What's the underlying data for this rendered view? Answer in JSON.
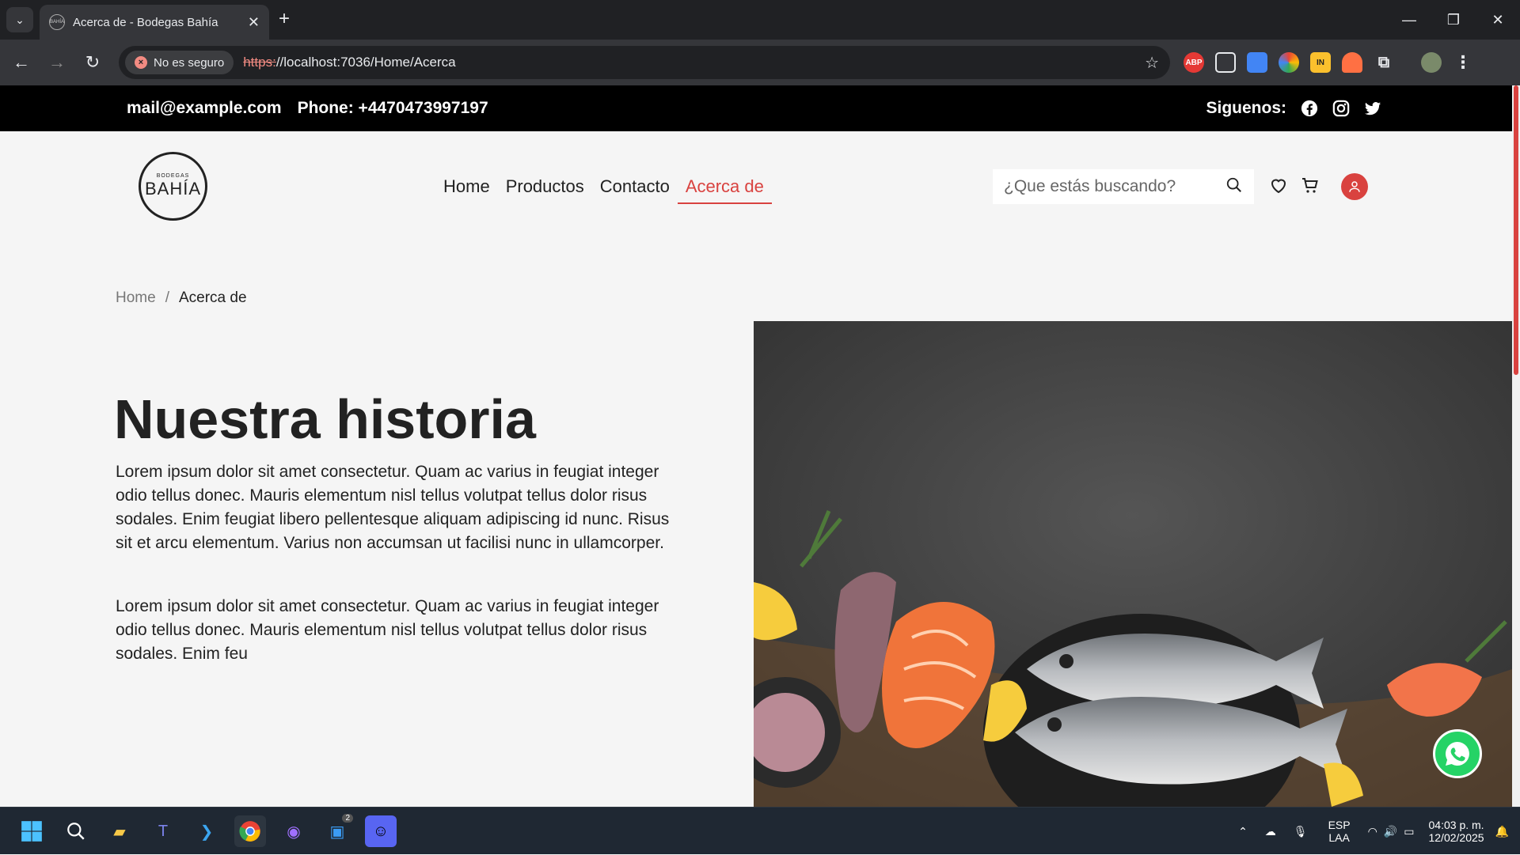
{
  "browser": {
    "tab_title": "Acerca de - Bodegas Bahía",
    "security_label": "No es seguro",
    "url_scheme": "https:",
    "url_rest": "//localhost:7036/Home/Acerca",
    "extensions": [
      {
        "name": "ABP",
        "color": "#e53935"
      },
      {
        "name": "",
        "color": "#e8eaed"
      },
      {
        "name": "",
        "color": "#4285f4"
      },
      {
        "name": "",
        "color": "#9c27b0"
      },
      {
        "name": "IN",
        "color": "#fbc02d"
      },
      {
        "name": "",
        "color": "#ff7043"
      }
    ]
  },
  "topbar": {
    "email": "mail@example.com",
    "phone": "Phone: +4470473997197",
    "follow_label": "Siguenos:"
  },
  "header": {
    "logo_small": "BODEGAS",
    "logo_big": "BAHÍA",
    "nav": [
      {
        "label": "Home"
      },
      {
        "label": "Productos"
      },
      {
        "label": "Contacto"
      },
      {
        "label": "Acerca de"
      }
    ],
    "search_placeholder": "¿Que estás buscando?"
  },
  "breadcrumb": {
    "home": "Home",
    "separator": "/",
    "current": "Acerca de"
  },
  "main": {
    "title": "Nuestra historia",
    "paragraph1": "Lorem ipsum dolor sit amet consectetur. Quam ac varius in feugiat integer odio tellus donec. Mauris elementum nisl tellus volutpat tellus dolor risus sodales. Enim feugiat libero pellentesque aliquam adipiscing id nunc. Risus sit et arcu elementum. Varius non accumsan ut facilisi nunc in ullamcorper.",
    "paragraph2": "Lorem ipsum dolor sit amet consectetur. Quam ac varius in feugiat integer odio tellus donec. Mauris elementum nisl tellus volutpat tellus dolor risus sodales. Enim feu"
  },
  "taskbar": {
    "lang": "ESP",
    "lang_sub": "LAA",
    "time": "04:03 p. m.",
    "date": "12/02/2025",
    "badge_count": "2"
  },
  "colors": {
    "accent": "#d9423f",
    "topbar_bg": "#000000"
  }
}
